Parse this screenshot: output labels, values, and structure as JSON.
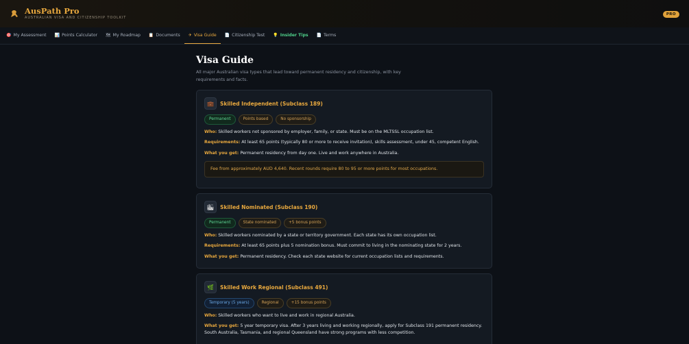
{
  "header": {
    "title": "AusPath Pro",
    "subtitle": "AUSTRALIAN VISA AND CITIZENSHIP TOOLKIT",
    "badge": "PRO"
  },
  "nav": {
    "items": [
      {
        "icon": "🎯",
        "label": "My Assessment"
      },
      {
        "icon": "📊",
        "label": "Points Calculator"
      },
      {
        "icon": "🗺",
        "label": "My Roadmap"
      },
      {
        "icon": "📋",
        "label": "Documents"
      },
      {
        "icon": "✈",
        "label": "Visa Guide"
      },
      {
        "icon": "📄",
        "label": "Citizenship Test"
      },
      {
        "icon": "💡",
        "label": "Insider Tips"
      },
      {
        "icon": "📄",
        "label": "Terms"
      }
    ],
    "active": "Visa Guide"
  },
  "page": {
    "title": "Visa Guide",
    "description": "All major Australian visa types that lead toward permanent residency and citizenship, with key requirements and facts."
  },
  "labels": {
    "who": "Who:",
    "requirements": "Requirements:",
    "what_you_get": "What you get:"
  },
  "cards": [
    {
      "icon": "💼",
      "title": "Skilled Independent (Subclass 189)",
      "tags": [
        "Permanent",
        "Points based",
        "No sponsorship"
      ],
      "who": "Skilled workers not sponsored by employer, family, or state. Must be on the MLTSSL occupation list.",
      "requirements": "At least 65 points (typically 80 or more to receive invitation), skills assessment, under 45, competent English.",
      "what_you_get": "Permanent residency from day one. Live and work anywhere in Australia.",
      "note": "Fee from approximately AUD 4,640. Recent rounds require 80 to 95 or more points for most occupations."
    },
    {
      "icon": "🏙",
      "title": "Skilled Nominated (Subclass 190)",
      "tags": [
        "Permanent",
        "State nominated",
        "+5 bonus points"
      ],
      "who": "Skilled workers nominated by a state or territory government. Each state has its own occupation list.",
      "requirements": "At least 65 points plus 5 nomination bonus. Must commit to living in the nominating state for 2 years.",
      "what_you_get": "Permanent residency. Check each state website for current occupation lists and requirements."
    },
    {
      "icon": "🌿",
      "title": "Skilled Work Regional (Subclass 491)",
      "tags": [
        "Temporary (5 years)",
        "Regional",
        "+15 bonus points"
      ],
      "who": "Skilled workers who want to live and work in regional Australia.",
      "what_you_get": "5 year temporary visa. After 3 years living and working regionally, apply for Subclass 191 permanent residency. South Australia, Tasmania, and regional Queensland have strong programs with less competition."
    }
  ]
}
